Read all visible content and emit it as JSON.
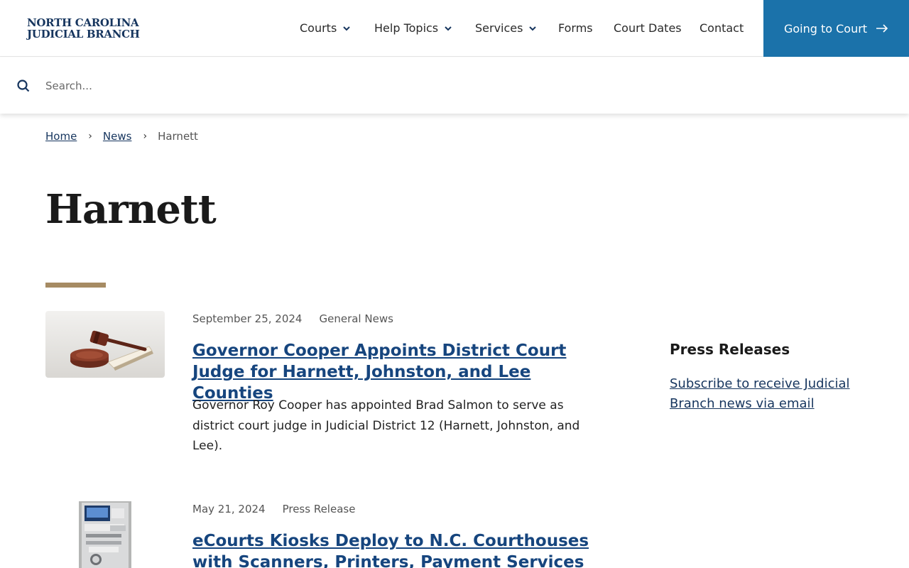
{
  "header": {
    "logo_line1": "NORTH CAROLINA",
    "logo_line2": "JUDICIAL BRANCH",
    "nav": [
      {
        "label": "Courts",
        "dropdown": true
      },
      {
        "label": "Help Topics",
        "dropdown": true
      },
      {
        "label": "Services",
        "dropdown": true
      },
      {
        "label": "Forms",
        "dropdown": false
      },
      {
        "label": "Court Dates",
        "dropdown": false
      },
      {
        "label": "Contact",
        "dropdown": false
      }
    ],
    "cta_label": "Going to Court",
    "cta_color": "#1b72aa"
  },
  "search": {
    "placeholder": "Search...",
    "value": ""
  },
  "breadcrumb": {
    "home": "Home",
    "news": "News",
    "current": "Harnett"
  },
  "page": {
    "title": "Harnett",
    "accent_color": "#a68b63"
  },
  "articles": [
    {
      "date": "September 25, 2024",
      "category": "General News",
      "title": "Governor Cooper Appoints District Court Judge for Harnett, Johnston, and Lee Counties",
      "summary": "Governor Roy Cooper has appointed Brad Salmon to serve as district court judge in Judicial District 12 (Harnett, Johnston, and Lee).",
      "image": "gavel-on-book"
    },
    {
      "date": "May 21, 2024",
      "category": "Press Release",
      "title": "eCourts Kiosks Deploy to N.C. Courthouses with Scanners, Printers, Payment Services for",
      "image": "ecourts-kiosk"
    }
  ],
  "sidebar": {
    "heading": "Press Releases",
    "link": "Subscribe to receive Judicial Branch news via email"
  }
}
